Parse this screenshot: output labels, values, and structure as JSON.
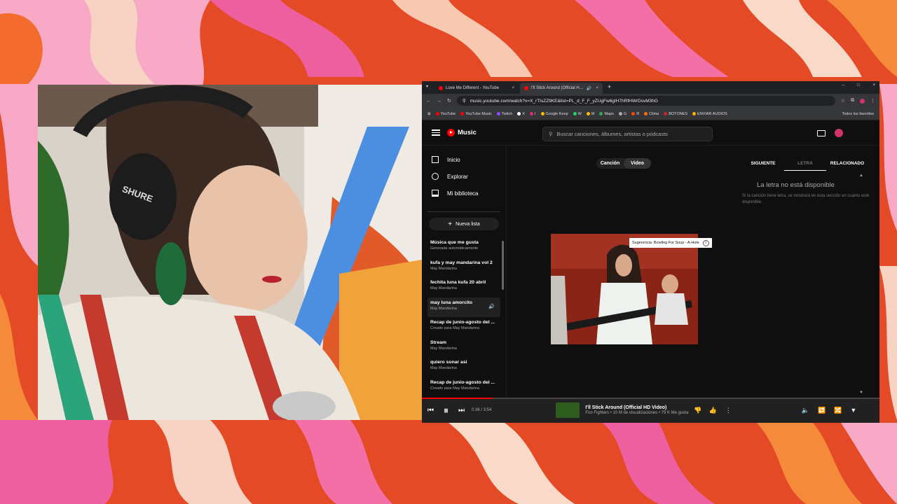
{
  "browser": {
    "tabs": [
      {
        "label": "Love Me Different - YouTube",
        "close": "×"
      },
      {
        "label": "I'll Stick Around (Official H…",
        "close": "×"
      }
    ],
    "new_tab": "+",
    "url": "music.youtube.com/watch?v=X_rTIsZZ9KE&list=PL_d_F_F_yZUgFw6gIH7hRfHWrDsvM3hG",
    "bookmarks": [
      {
        "label": "YouTube",
        "color": "#ff0000"
      },
      {
        "label": "YouTube Music",
        "color": "#ff0000"
      },
      {
        "label": "Twitch",
        "color": "#9146ff"
      },
      {
        "label": "X",
        "color": "#ffffff"
      },
      {
        "label": "I",
        "color": "#e1306c"
      },
      {
        "label": "Google Keep",
        "color": "#fbbc04"
      },
      {
        "label": "W",
        "color": "#25d366"
      },
      {
        "label": "M",
        "color": "#fbbc04"
      },
      {
        "label": "Maps",
        "color": "#34a853"
      },
      {
        "label": "G",
        "color": "#aaaaaa"
      },
      {
        "label": "R",
        "color": "#ff4500"
      },
      {
        "label": "Clima",
        "color": "#ff6d00"
      },
      {
        "label": "BOTONES",
        "color": "#c62828"
      },
      {
        "label": "ENVIAR AUDIOS",
        "color": "#ffb300"
      }
    ],
    "all_bookmarks": "Todos los favoritos"
  },
  "header": {
    "logo": "Music",
    "search_placeholder": "Buscar canciones, álbumes, artistas o pódcasts"
  },
  "sidebar": {
    "nav": [
      {
        "label": "Inicio",
        "icon": "home-icon"
      },
      {
        "label": "Explorar",
        "icon": "explore-icon"
      },
      {
        "label": "Mi biblioteca",
        "icon": "library-icon"
      }
    ],
    "new_playlist": "Nueva lista",
    "playlists": [
      {
        "title": "Música que me gusta",
        "sub": "Generada automáticamente"
      },
      {
        "title": "kufa y may mandarina vol 2",
        "sub": "May Mandarina"
      },
      {
        "title": "fechita luna kufa 20 abril",
        "sub": "May Mandarina"
      },
      {
        "title": "may luna amorcito",
        "sub": "May Mandarina"
      },
      {
        "title": "Recap de junio-agosto del ...",
        "sub": "Creado para May Mandarina"
      },
      {
        "title": "Stream",
        "sub": "May Mandarina"
      },
      {
        "title": "quiero sonar asi",
        "sub": "May Mandarina"
      },
      {
        "title": "Recap de junio-agosto del ...",
        "sub": "Creado para May Mandarina"
      }
    ]
  },
  "main": {
    "toggle": [
      "Canción",
      "Video"
    ],
    "suggestion": "Sugerencia: Bowling For Soup - A-Hole",
    "right_tabs": [
      "SIGUIENTE",
      "LETRA",
      "RELACIONADO"
    ],
    "lyrics_title": "La letra no está disponible",
    "lyrics_body": "Si la canción tiene letra, se mostrará en esta sección en cuanto esté disponible."
  },
  "player": {
    "time": "0:36 / 3:54",
    "progress": 0.154,
    "title": "I'll Stick Around (Official HD Video)",
    "subtitle": "Foo Fighters • 10 M de visualizaciones • 79 K Me gusta"
  }
}
